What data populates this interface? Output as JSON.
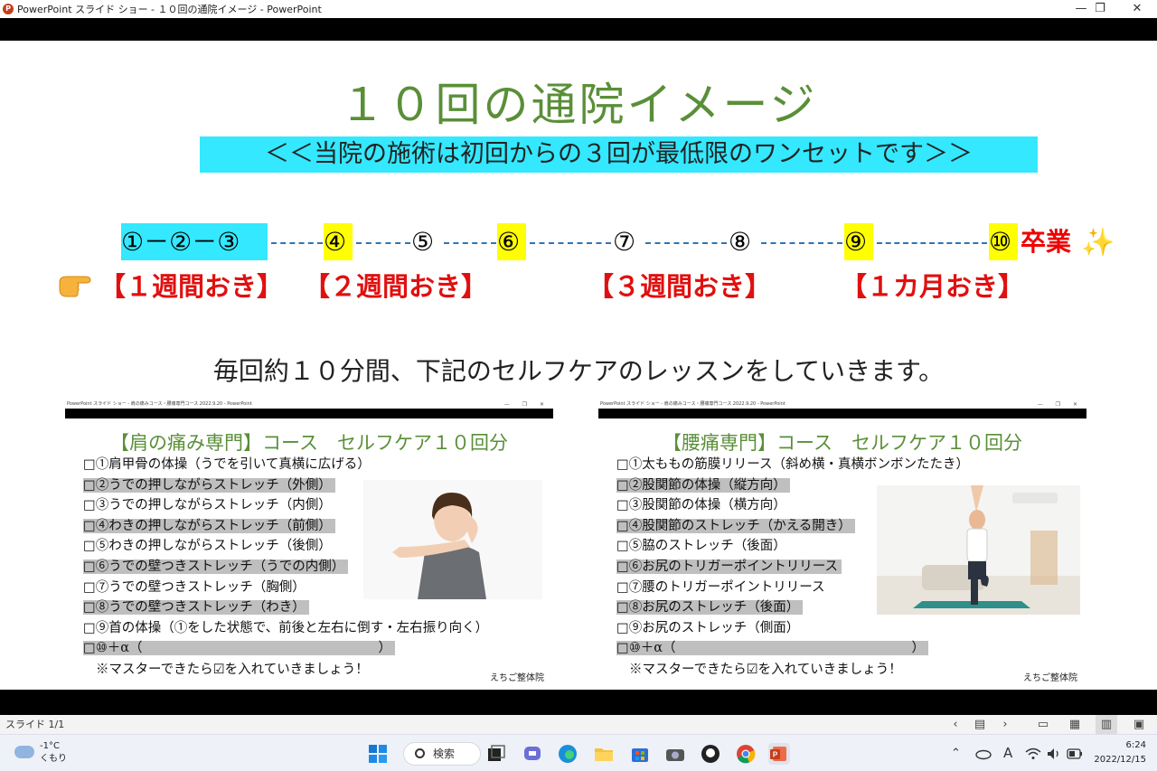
{
  "window": {
    "title": "PowerPoint スライド ショー - １０回の通院イメージ - PowerPoint",
    "minimize": "—",
    "restore": "❐",
    "close": "✕"
  },
  "slide": {
    "title": "１０回の通院イメージ",
    "subtitle": "＜＜当院の施術は初回からの３回が最低限のワンセットです＞＞",
    "timeline": {
      "first_set": "①－②－③",
      "v4": "④",
      "v5": "⑤",
      "v6": "⑥",
      "v7": "⑦",
      "v8": "⑧",
      "v9": "⑨",
      "v10": "⑩",
      "graduation": "卒業",
      "sparkle": "✨"
    },
    "intervals": {
      "weekly": "【１週間おき】",
      "biweekly": "【２週間おき】",
      "triweekly": "【３週間おき】",
      "monthly": "【１カ月おき】"
    },
    "lesson_text": "毎回約１０分間、下記のセルフケアのレッスンをしていきます。",
    "shoulder": {
      "titlebar": "PowerPoint スライド ショー - 肩の痛みコース・腰痛専門コース 2022.9.20 - PowerPoint",
      "window_controls": "— ❐ ✕",
      "heading": "【肩の痛み専門】コース　セルフケア１０回分",
      "items": [
        "□①肩甲骨の体操（うでを引いて真横に広げる）",
        "□②うでの押しながらストレッチ（外側）",
        "□③うでの押しながらストレッチ（内側）",
        "□④わきの押しながらストレッチ（前側）",
        "□⑤わきの押しながらストレッチ（後側）",
        "□⑥うでの壁つきストレッチ（うでの内側）",
        "□⑦うでの壁つきストレッチ（胸側）",
        "□⑧うでの壁つきストレッチ（わき）",
        "□⑨首の体操（①をした状態で、前後と左右に倒す・左右振り向く）",
        "□⑩＋α（　　　　　　　　　　　　　　　　　　）"
      ],
      "note": "※マスターできたら☑を入れていきましょう！",
      "clinic": "えちご整体院"
    },
    "back": {
      "titlebar": "PowerPoint スライド ショー - 肩の痛みコース・腰痛専門コース 2022.9.20 - PowerPoint",
      "window_controls": "— ❐ ✕",
      "heading": "【腰痛専門】コース　セルフケア１０回分",
      "items": [
        "□①太ももの筋膜リリース（斜め横・真横ボンボンたたき）",
        "□②股関節の体操（縦方向）",
        "□③股関節の体操（横方向）",
        "□④股関節のストレッチ（かえる開き）",
        "□⑤脇のストレッチ（後面）",
        "□⑥お尻のトリガーポイントリリース",
        "□⑦腰のトリガーポイントリリース",
        "□⑧お尻のストレッチ（後面）",
        "□⑨お尻のストレッチ（側面）",
        "□⑩＋α（　　　　　　　　　　　　　　　　　　）"
      ],
      "note": "※マスターできたら☑を入れていきましょう！",
      "clinic": "えちご整体院"
    }
  },
  "statusbar": {
    "slide_counter": "スライド 1/1",
    "prev": "‹",
    "menu": "▤",
    "next": "›",
    "normal": "▭",
    "sorter": "▦",
    "reading": "▥",
    "slideshow": "▣"
  },
  "taskbar": {
    "temp": "-1°C",
    "weather": "くもり",
    "search": "検索",
    "ime": "A",
    "time": "6:24",
    "date": "2022/12/15",
    "colors": {
      "edge": "#1a8fd8",
      "explorer": "#f5c242",
      "store": "#2b6fd6",
      "ppt": "#c43e1c"
    }
  }
}
